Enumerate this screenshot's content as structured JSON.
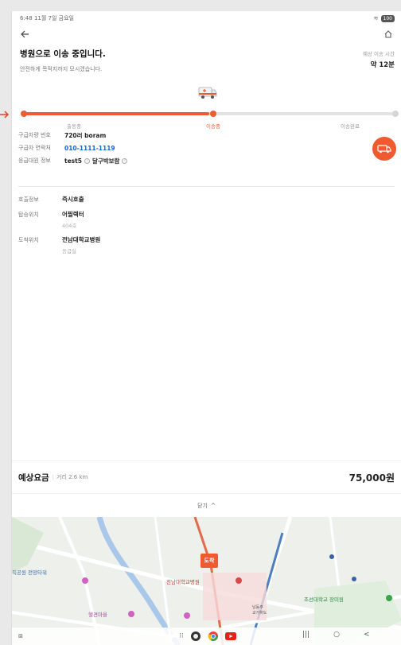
{
  "status_bar": {
    "time": "6:48",
    "date": "11월 7일 금요일"
  },
  "header": {
    "title": "병원으로 이송 중입니다.",
    "subtitle": "안전하게 목적지까지 모시겠습니다.",
    "eta_label": "예상 이송 시간",
    "eta_value": "약 12분"
  },
  "progress": {
    "steps": [
      "출동중",
      "이송중",
      "이송완료"
    ],
    "active_step": "이송중",
    "fraction": 0.5
  },
  "vehicle_info": {
    "vehicle_number_label": "구급차량 번호",
    "vehicle_number": "720러 boram",
    "contact_label": "구급차 연락처",
    "contact": "010-1111-1119",
    "crew_label": "응급대원 정보",
    "crew_name": "test5",
    "crew_role": "달구박보람"
  },
  "route": {
    "call_label": "호출정보",
    "call_value": "즉시호출",
    "pickup_label": "탑승위치",
    "pickup_value": "어필렉터",
    "pickup_detail": "404호",
    "arrival_label": "도착위치",
    "arrival_value": "전남대학교병원",
    "arrival_detail": "응급실"
  },
  "fare": {
    "label": "예상요금",
    "distance": "거리 2.6 km",
    "amount": "75,000원"
  },
  "close_label": "닫기",
  "map": {
    "arrive_tag": "도착",
    "labels": {
      "park": "직공원 전망타워",
      "hospital": "전남대학교병원",
      "school": "조선대학교 장미원",
      "village": "헬견마을",
      "station": "남동주\n교가하도"
    }
  },
  "colors": {
    "accent": "#ef5a2f",
    "link": "#1b62c9"
  }
}
